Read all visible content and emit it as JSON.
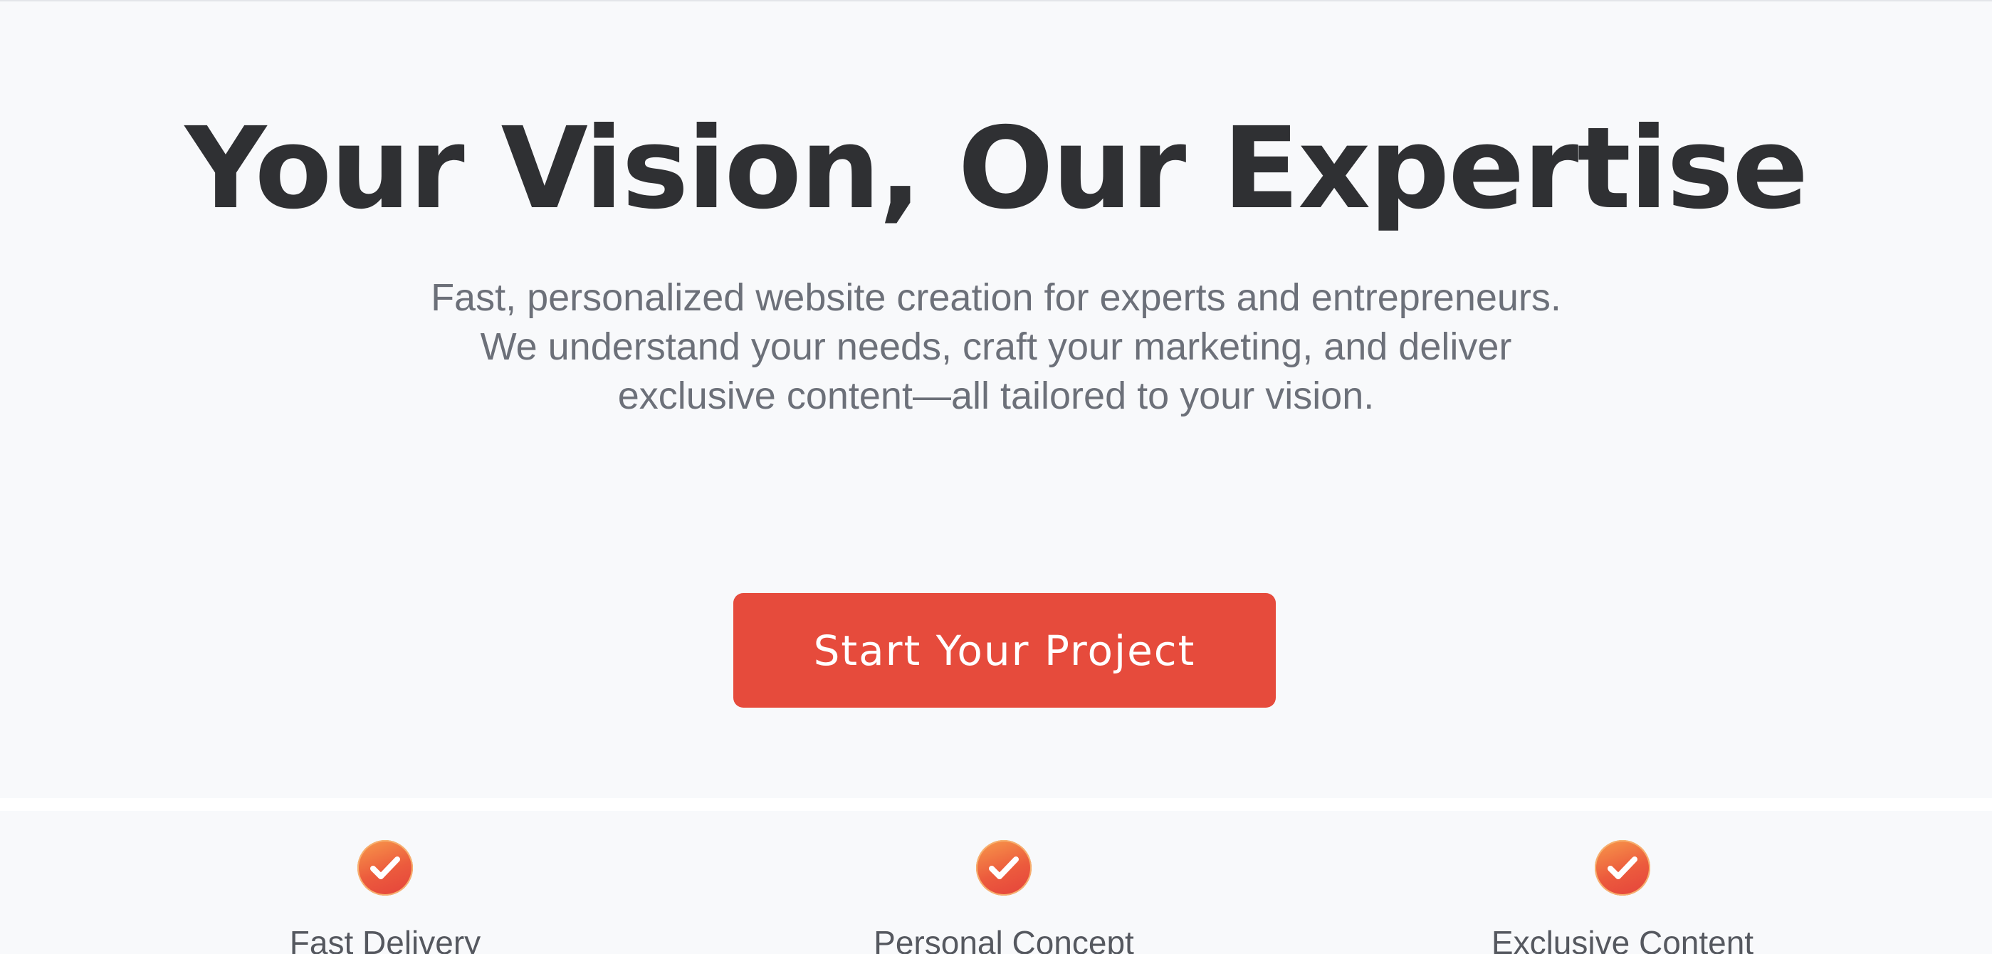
{
  "hero": {
    "title": "Your Vision, Our Expertise",
    "subtitle_lines": [
      "Fast, personalized website creation for experts and entrepreneurs.",
      "We understand your needs, craft your marketing, and deliver",
      "exclusive content—all tailored to your vision."
    ],
    "cta_label": "Start Your Project"
  },
  "features": [
    {
      "label": "Fast Delivery",
      "icon": "check-circle-icon"
    },
    {
      "label": "Personal Concept",
      "icon": "check-circle-icon"
    },
    {
      "label": "Exclusive Content",
      "icon": "check-circle-icon"
    }
  ],
  "colors": {
    "background": "#f8f9fb",
    "title": "#2f3033",
    "subtitle": "#6c7079",
    "accent": "#e64b3c",
    "feature_label": "#55585f"
  }
}
